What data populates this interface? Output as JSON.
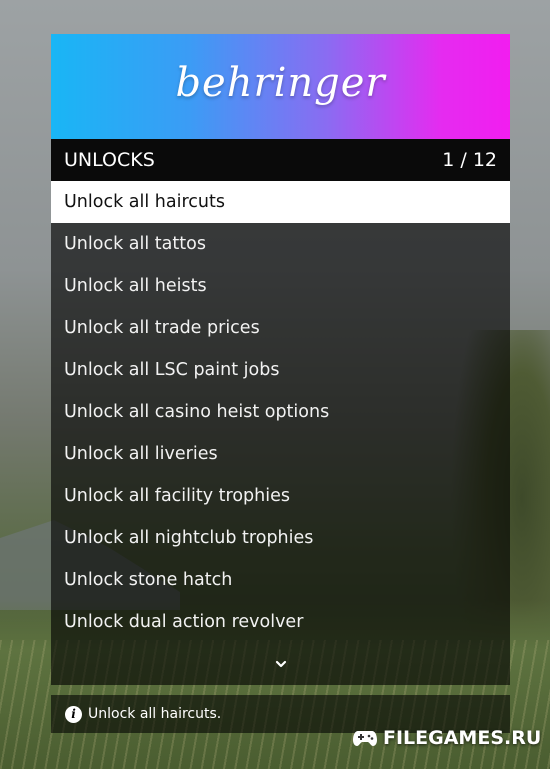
{
  "banner": {
    "title": "behringer"
  },
  "subheader": {
    "title": "UNLOCKS",
    "counter": "1 / 12"
  },
  "items": [
    {
      "label": "Unlock all haircuts",
      "selected": true
    },
    {
      "label": "Unlock all tattos"
    },
    {
      "label": "Unlock all heists"
    },
    {
      "label": "Unlock all trade prices"
    },
    {
      "label": "Unlock all LSC paint jobs"
    },
    {
      "label": "Unlock all casino heist options"
    },
    {
      "label": "Unlock all liveries"
    },
    {
      "label": "Unlock all facility trophies"
    },
    {
      "label": "Unlock all nightclub trophies"
    },
    {
      "label": "Unlock stone hatch"
    },
    {
      "label": "Unlock dual action revolver"
    }
  ],
  "footer": {
    "arrow_icon": "chevron-down-icon"
  },
  "description": {
    "icon": "info-icon",
    "text": "Unlock all haircuts."
  },
  "watermark": {
    "icon": "gamepad-icon",
    "text": "FILEGAMES.RU"
  },
  "colors": {
    "banner_gradient_start": "#19b6f5",
    "banner_gradient_end": "#f21df0",
    "selected_bg": "#ffffff",
    "header_bg": "#0a0a0a"
  }
}
